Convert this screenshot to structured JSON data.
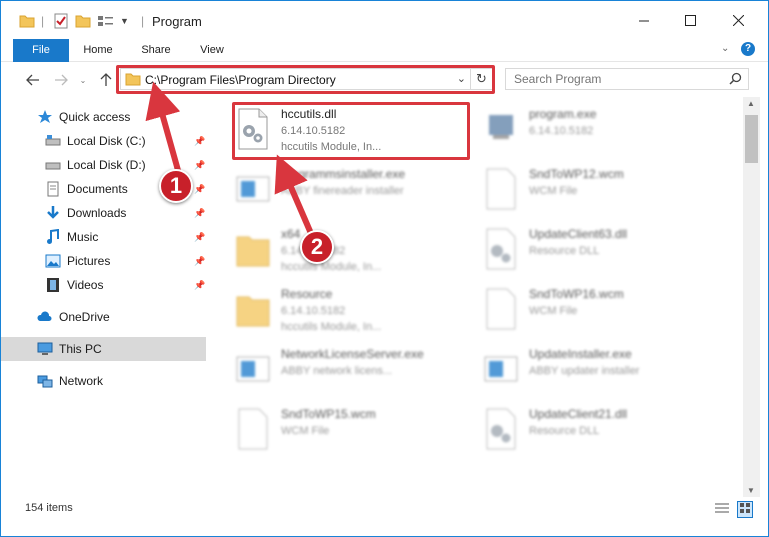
{
  "window": {
    "title": "Program"
  },
  "title_buttons": [
    "minimize-button",
    "maximize-button",
    "close-button"
  ],
  "ribbon": {
    "tabs": [
      "File",
      "Home",
      "Share",
      "View"
    ]
  },
  "address": {
    "path": "C:\\Program Files\\Program Directory",
    "search_placeholder": "Search Program"
  },
  "nav": {
    "items": [
      {
        "label": "Quick access"
      },
      {
        "label": "Local Disk (C:)"
      },
      {
        "label": "Local Disk (D:)"
      },
      {
        "label": "Documents"
      },
      {
        "label": "Downloads"
      },
      {
        "label": "Music"
      },
      {
        "label": "Pictures"
      },
      {
        "label": "Videos"
      },
      {
        "label": "OneDrive"
      },
      {
        "label": "This PC"
      },
      {
        "label": "Network"
      }
    ]
  },
  "files": [
    {
      "name": "hccutils.dll",
      "line1": "6.14.10.5182",
      "line2": "hccutils Module, In..."
    },
    {
      "name": "program.exe",
      "line1": "6.14.10.5182",
      "line2": ""
    },
    {
      "name": "programmsinstaller.exe",
      "line1": "ABBY finereader installer",
      "line2": ""
    },
    {
      "name": "SndToWP12.wcm",
      "line1": "WCM File",
      "line2": ""
    },
    {
      "name": "x64",
      "line1": "6.14.10.5182",
      "line2": "hccutils Module, In..."
    },
    {
      "name": "UpdateClient63.dll",
      "line1": "Resource DLL",
      "line2": ""
    },
    {
      "name": "Resource",
      "line1": "6.14.10.5182",
      "line2": "hccutils Module, In..."
    },
    {
      "name": "SndToWP16.wcm",
      "line1": "WCM File",
      "line2": ""
    },
    {
      "name": "NetworkLicenseServer.exe",
      "line1": "ABBY network licens...",
      "line2": ""
    },
    {
      "name": "UpdateInstaller.exe",
      "line1": "ABBY updater installer",
      "line2": ""
    },
    {
      "name": "SndToWP15.wcm",
      "line1": "WCM File",
      "line2": ""
    },
    {
      "name": "UpdateClient21.dll",
      "line1": "Resource DLL",
      "line2": ""
    }
  ],
  "status": {
    "count": "154 items"
  },
  "callouts": [
    "1",
    "2"
  ],
  "colors": {
    "accent": "#1979ca",
    "highlight": "#d9363e"
  }
}
